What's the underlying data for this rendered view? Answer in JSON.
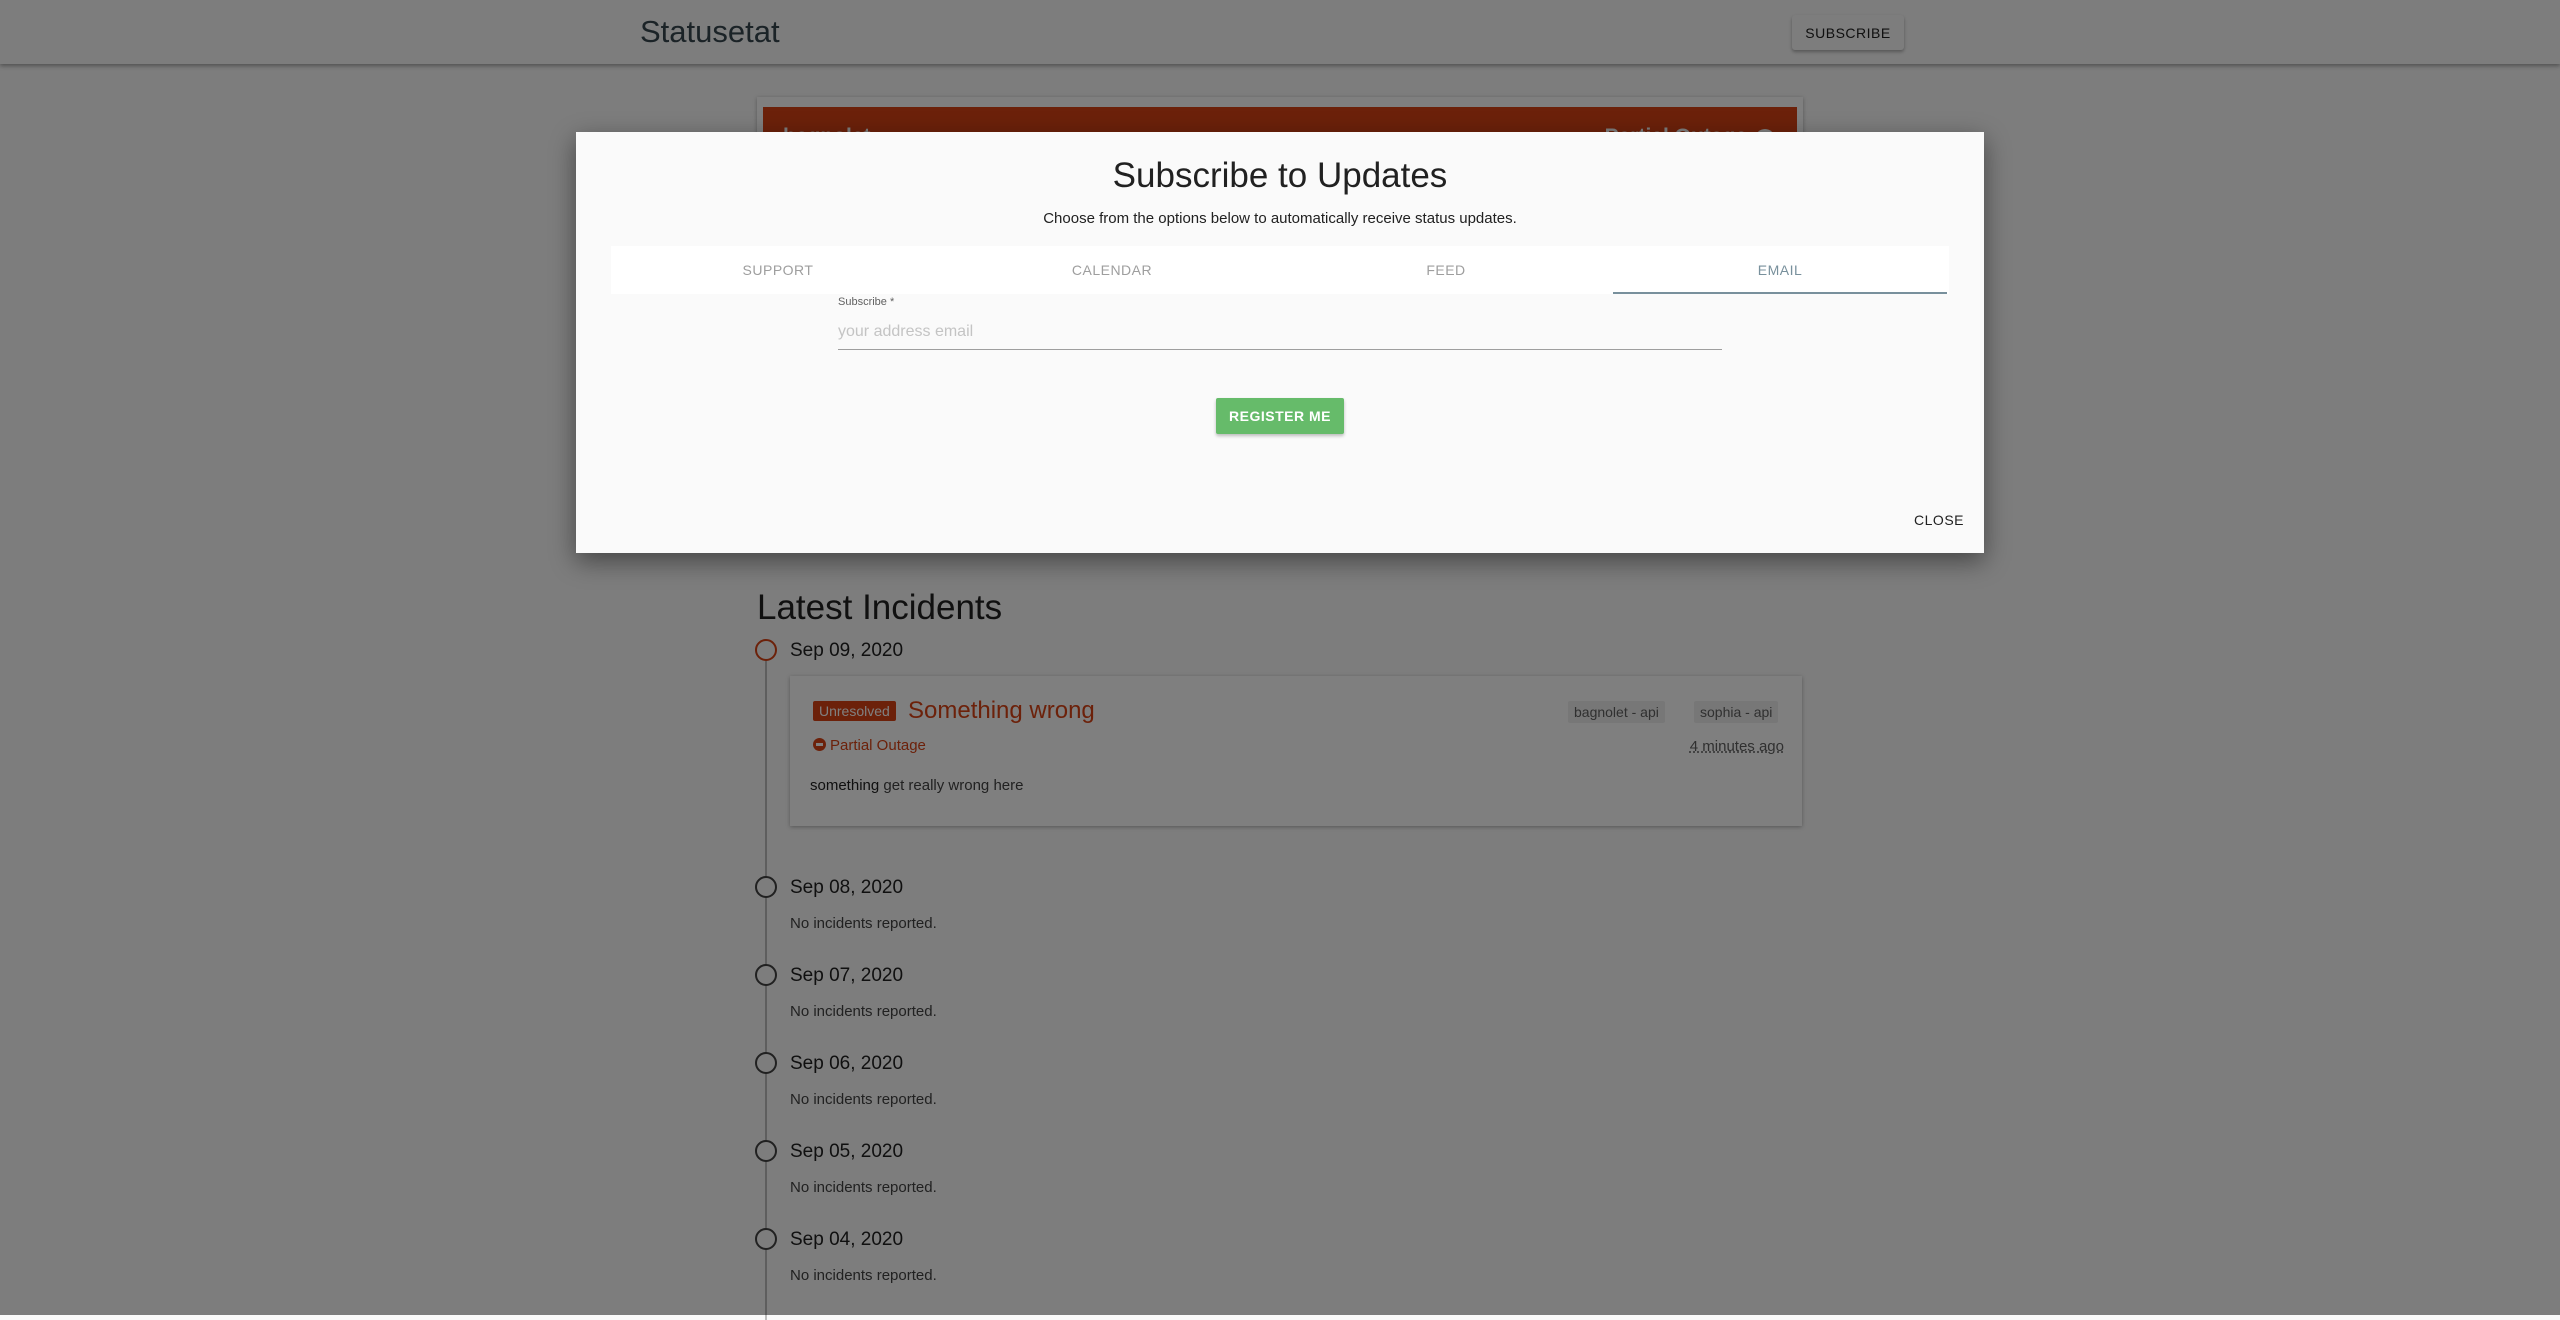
{
  "header": {
    "brand": "Statusetat",
    "subscribe_label": "SUBSCRIBE"
  },
  "component": {
    "name": "bagnolet",
    "status": "Partial Outage",
    "color": "#d84315"
  },
  "incidents": {
    "title": "Latest Incidents",
    "days": [
      {
        "date": "Sep 09, 2020",
        "has_incident": true
      },
      {
        "date": "Sep 08, 2020",
        "text": "No incidents reported."
      },
      {
        "date": "Sep 07, 2020",
        "text": "No incidents reported."
      },
      {
        "date": "Sep 06, 2020",
        "text": "No incidents reported."
      },
      {
        "date": "Sep 05, 2020",
        "text": "No incidents reported."
      },
      {
        "date": "Sep 04, 2020",
        "text": "No incidents reported."
      }
    ],
    "incident": {
      "badge": "Unresolved",
      "title": "Something wrong",
      "tags": [
        "bagnolet - api",
        "sophia - api"
      ],
      "status": "Partial Outage",
      "time": "4 minutes ago",
      "body_bold": "something",
      "body_rest": " get really wrong here"
    }
  },
  "modal": {
    "title": "Subscribe to Updates",
    "subtitle": "Choose from the options below to automatically receive status updates.",
    "tabs": [
      {
        "label": "SUPPORT",
        "active": false
      },
      {
        "label": "CALENDAR",
        "active": false
      },
      {
        "label": "FEED",
        "active": false
      },
      {
        "label": "EMAIL",
        "active": true
      }
    ],
    "field_label": "Subscribe *",
    "email_placeholder": "your address email",
    "email_value": "",
    "register_label": "REGISTER ME",
    "close_label": "CLOSE"
  },
  "colors": {
    "accent": "#d84315",
    "success": "#66bb6a",
    "tab_active": "#78909c"
  }
}
